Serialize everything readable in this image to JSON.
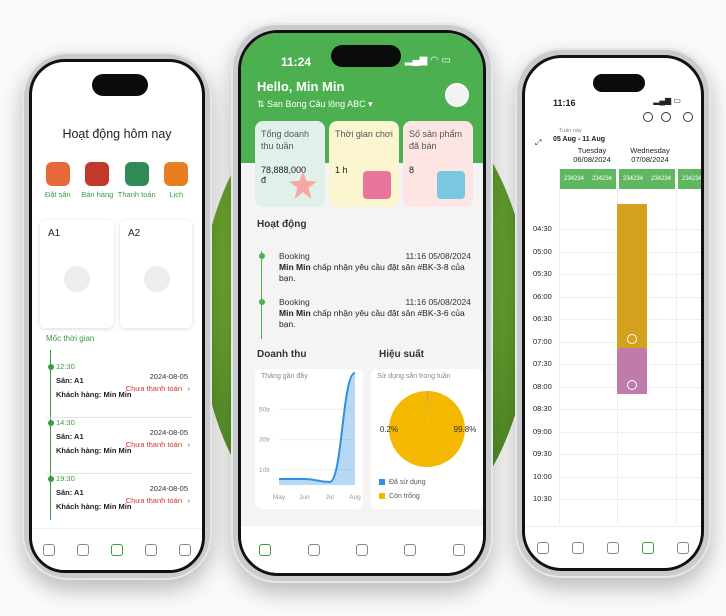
{
  "left": {
    "title": "Hoạt động hôm nay",
    "menu": [
      {
        "label": "Đặt sân",
        "icon": "court-booking-icon",
        "color": "#e86a3a"
      },
      {
        "label": "Bán hàng",
        "icon": "drinks-icon",
        "color": "#c0392b"
      },
      {
        "label": "Thanh toán",
        "icon": "payment-icon",
        "color": "#2e8b57"
      },
      {
        "label": "Lịch",
        "icon": "calendar-icon",
        "color": "#e67e22"
      }
    ],
    "courts": [
      {
        "label": "A1"
      },
      {
        "label": "A2"
      }
    ],
    "timeline_title": "Mốc thời gian",
    "entries": [
      {
        "time": "12:30",
        "date": "2024-08-05",
        "court": "Sân: A1",
        "customer": "Khách hàng: Min Min",
        "status": "Chưa thanh toán"
      },
      {
        "time": "14:30",
        "date": "2024-08-05",
        "court": "Sân: A1",
        "customer": "Khách hàng: Min Min",
        "status": "Chưa thanh toán"
      },
      {
        "time": "19:30",
        "date": "2024-08-05",
        "court": "Sân: A1",
        "customer": "Khách hàng: Min Min",
        "status": "Chưa thanh toán"
      }
    ]
  },
  "center": {
    "status_time": "11:24",
    "greeting": "Hello, Min Min",
    "venue": "San Bong Cầu lông ABC",
    "stats": [
      {
        "label": "Tổng doanh thu tuần",
        "value": "78,888,000 đ",
        "color": "#dff1ea"
      },
      {
        "label": "Thời gian chơi",
        "value": "1 h",
        "color": "#fbf5d0"
      },
      {
        "label": "Số sản phẩm đã bán",
        "value": "8",
        "color": "#fde5e4"
      }
    ],
    "activity_title": "Hoạt động",
    "activities": [
      {
        "type": "Booking",
        "time": "11:16 05/08/2024",
        "user": "Min Min",
        "msg": " chấp nhận yêu cầu đặt sân #BK-3-8 của bạn."
      },
      {
        "type": "Booking",
        "time": "11:16 05/08/2024",
        "user": "Min Min",
        "msg": " chấp nhận yêu cầu đặt sân #BK-3-6 của bạn."
      }
    ],
    "revenue": {
      "title": "Doanh thu",
      "subtitle": "Tháng gần đây"
    },
    "performance": {
      "title": "Hiệu suất",
      "subtitle": "Sử dụng sân trong tuần",
      "legend_used": "Đã sử dụng",
      "legend_free": "Còn trống",
      "used_label": "0.2%",
      "free_label": "99.8%"
    }
  },
  "chart_data": [
    {
      "type": "area",
      "subtitle": "Tháng gần đây",
      "categories": [
        "May",
        "Jun",
        "Jul",
        "Aug"
      ],
      "values": [
        4,
        4,
        2,
        82
      ],
      "y_ticks": [
        "10tr",
        "30tr",
        "50tr"
      ],
      "ylim": [
        0,
        70
      ],
      "color": "#2f8fe0"
    },
    {
      "type": "pie",
      "subtitle": "Sử dụng sân trong tuần",
      "slices": [
        {
          "name": "Đã sử dụng",
          "value": 0.2,
          "color": "#2f8fe0"
        },
        {
          "name": "Còn trống",
          "value": 99.8,
          "color": "#f5b800"
        }
      ]
    }
  ],
  "right": {
    "status_time": "11:16",
    "week_label": "Tuần này",
    "week_range": "05 Aug - 11 Aug",
    "days": [
      {
        "name": "Tuesday",
        "date": "06/08/2024"
      },
      {
        "name": "Wednesday",
        "date": "07/08/2024"
      }
    ],
    "slot_label": "234234",
    "hours": [
      "04:30",
      "05:00",
      "05:30",
      "06:00",
      "06:30",
      "07:00",
      "07:30",
      "08:00",
      "08:30",
      "09:00",
      "09:30",
      "10:00",
      "10:30"
    ],
    "colors": {
      "gold": "#d4a11e",
      "mauve": "#c07aab",
      "green": "#5fb760"
    }
  }
}
